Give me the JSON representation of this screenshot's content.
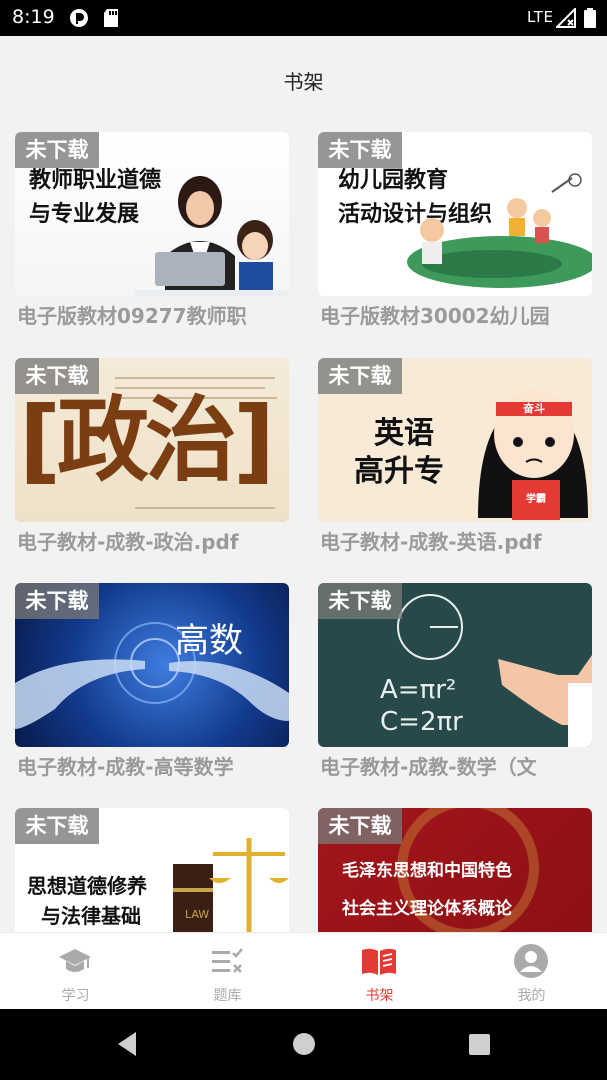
{
  "status_bar": {
    "time": "8:19",
    "network": "LTE"
  },
  "header": {
    "title": "书架"
  },
  "books": [
    {
      "badge": "未下载",
      "name": "电子版教材09277教师职",
      "cover_text": [
        "教师职业道德",
        "与专业发展"
      ]
    },
    {
      "badge": "未下载",
      "name": "电子版教材30002幼儿园",
      "cover_text": [
        "幼儿园教育",
        "活动设计与组织"
      ]
    },
    {
      "badge": "未下载",
      "name": "电子教材-成教-政治.pdf",
      "cover_text": [
        "[政治]"
      ]
    },
    {
      "badge": "未下载",
      "name": "电子教材-成教-英语.pdf",
      "cover_text": [
        "英语",
        "高升专",
        "奋斗",
        "学霸"
      ]
    },
    {
      "badge": "未下载",
      "name": "电子教材-成教-高等数学",
      "cover_text": [
        "高数"
      ]
    },
    {
      "badge": "未下载",
      "name": "电子教材-成教-数学（文",
      "cover_text": [
        "A=πr²",
        "C=2πr"
      ]
    },
    {
      "badge": "未下载",
      "name": "",
      "cover_text": [
        "思想道德修养",
        "与法律基础",
        "LAW"
      ]
    },
    {
      "badge": "未下载",
      "name": "",
      "cover_text": [
        "毛泽东思想和中国特色",
        "社会主义理论体系概论"
      ]
    }
  ],
  "tabs": [
    {
      "label": "学习",
      "icon": "graduation-cap-icon"
    },
    {
      "label": "题库",
      "icon": "checklist-icon"
    },
    {
      "label": "书架",
      "icon": "open-book-icon",
      "active": true
    },
    {
      "label": "我的",
      "icon": "person-icon"
    }
  ],
  "colors": {
    "accent": "#e53935",
    "inactive": "#aaaaaa"
  }
}
